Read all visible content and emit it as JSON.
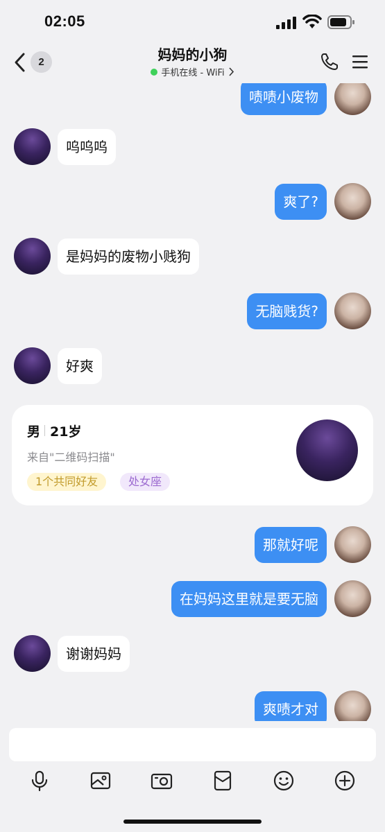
{
  "status_bar": {
    "time": "02:05"
  },
  "nav": {
    "unread_count": "2",
    "title": "妈妈的小狗",
    "status": "手机在线 - WiFi"
  },
  "messages": [
    {
      "side": "right",
      "text": "啧啧小废物"
    },
    {
      "side": "left",
      "text": "呜呜呜"
    },
    {
      "side": "right",
      "text": "爽了?"
    },
    {
      "side": "left",
      "text": "是妈妈的废物小贱狗"
    },
    {
      "side": "right",
      "text": "无脑贱货?"
    },
    {
      "side": "left",
      "text": "好爽"
    },
    {
      "side": "right",
      "text": "那就好呢"
    },
    {
      "side": "right",
      "text": "在妈妈这里就是要无脑"
    },
    {
      "side": "left",
      "text": "谢谢妈妈"
    },
    {
      "side": "right",
      "text": "爽啧才对"
    }
  ],
  "profile_card": {
    "gender": "男",
    "age": "21岁",
    "source": "来自\"二维码扫描\"",
    "tag_mutual": "1个共同好友",
    "tag_zodiac": "处女座"
  },
  "input": {
    "value": ""
  },
  "colors": {
    "self_bubble": "#3d8ff3",
    "other_bubble": "#ffffff",
    "online": "#3fd15a",
    "background": "#f1f1f3"
  },
  "toolbar_icons": [
    "microphone-icon",
    "image-icon",
    "camera-icon",
    "red-packet-icon",
    "emoji-icon",
    "plus-icon"
  ]
}
